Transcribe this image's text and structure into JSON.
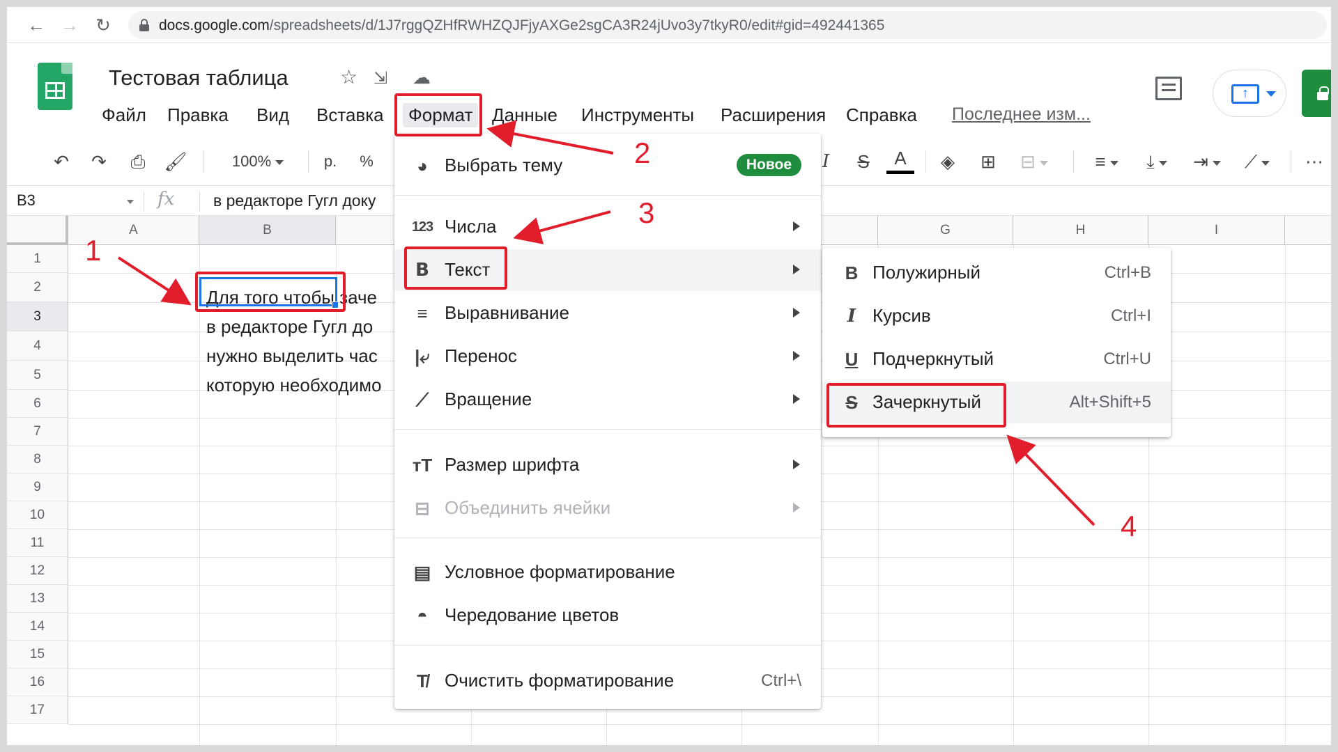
{
  "browser": {
    "url_host": "docs.google.com",
    "url_path": "/spreadsheets/d/1J7rggQZHfRWHZQJFjyAXGe2sgCA3R24jUvo3y7tkyR0/edit#gid=492441365"
  },
  "doc": {
    "title": "Тестовая таблица",
    "last_edit": "Последнее изм..."
  },
  "menubar": [
    "Файл",
    "Правка",
    "Вид",
    "Вставка",
    "Формат",
    "Данные",
    "Инструменты",
    "Расширения",
    "Справка"
  ],
  "toolbar": {
    "zoom": "100%",
    "currency": "р.",
    "percent": "%"
  },
  "formula_bar": {
    "cell_ref": "B3",
    "fx": "fx",
    "content": "в редакторе Гугл доку"
  },
  "columns": [
    "A",
    "B",
    "",
    "",
    "",
    "",
    "G",
    "H",
    "I"
  ],
  "rows": [
    "1",
    "2",
    "3",
    "4",
    "5",
    "6",
    "7",
    "8",
    "9",
    "10",
    "11",
    "12",
    "13",
    "14",
    "15",
    "16",
    "17"
  ],
  "cells": {
    "b2": "Для того чтобы заче",
    "b3": "в редакторе Гугл до",
    "b4": "нужно выделить час",
    "b5": "которую необходимо"
  },
  "format_menu": {
    "items": [
      {
        "label": "Выбрать тему",
        "icon": "palette-icon",
        "badge": "Новое"
      },
      {
        "label": "Числа",
        "icon": "numbers-icon",
        "icon_glyph": "123",
        "submenu": true
      },
      {
        "label": "Текст",
        "icon": "bold-text-icon",
        "icon_glyph": "B",
        "submenu": true
      },
      {
        "label": "Выравнивание",
        "icon": "align-icon",
        "submenu": true
      },
      {
        "label": "Перенос",
        "icon": "wrap-icon",
        "submenu": true
      },
      {
        "label": "Вращение",
        "icon": "rotate-icon",
        "submenu": true
      },
      {
        "label": "Размер шрифта",
        "icon": "font-size-icon",
        "icon_glyph": "тT",
        "submenu": true
      },
      {
        "label": "Объединить ячейки",
        "icon": "merge-icon",
        "submenu": true,
        "disabled": true
      },
      {
        "label": "Условное форматирование",
        "icon": "paint-roller-icon"
      },
      {
        "label": "Чередование цветов",
        "icon": "color-drop-icon"
      },
      {
        "label": "Очистить форматирование",
        "icon": "clear-format-icon",
        "shortcut": "Ctrl+\\"
      }
    ]
  },
  "text_menu": {
    "items": [
      {
        "label": "Полужирный",
        "icon_glyph": "B",
        "shortcut": "Ctrl+B"
      },
      {
        "label": "Курсив",
        "icon_glyph": "I",
        "shortcut": "Ctrl+I"
      },
      {
        "label": "Подчеркнутый",
        "icon_glyph": "U",
        "shortcut": "Ctrl+U"
      },
      {
        "label": "Зачеркнутый",
        "icon_glyph": "S",
        "shortcut": "Alt+Shift+5"
      }
    ]
  },
  "annotations": [
    "1",
    "2",
    "3",
    "4"
  ],
  "colors": {
    "annotation_red": "#e21d2b",
    "sheets_green": "#23a566",
    "selection_blue": "#1a73e8",
    "badge_green": "#1e8e3e"
  }
}
